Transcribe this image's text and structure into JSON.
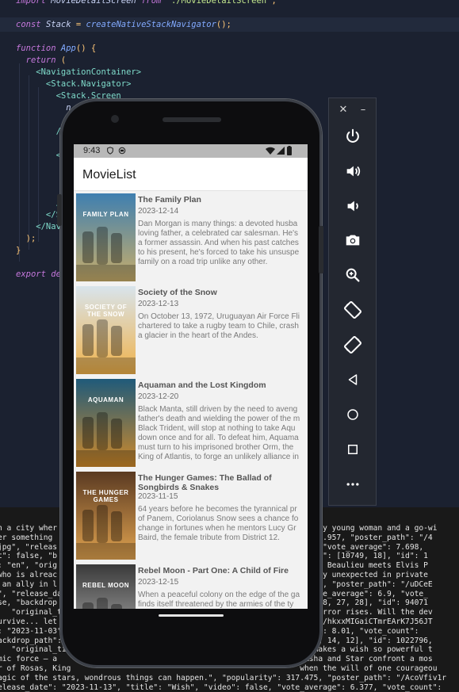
{
  "editor": {
    "lines": [
      {
        "parts": [
          [
            "kw",
            "import "
          ],
          [
            "id",
            "MovieDetailScreen "
          ],
          [
            "kw",
            "from "
          ],
          [
            "str",
            "'./MovieDetailScreen'"
          ],
          [
            "pun",
            ";"
          ]
        ]
      },
      {
        "parts": []
      },
      {
        "parts": [
          [
            "kw",
            "const "
          ],
          [
            "id",
            "Stack "
          ],
          [
            "pun",
            "= "
          ],
          [
            "fn",
            "createNativeStackNavigator"
          ],
          [
            "pun",
            "();"
          ]
        ]
      },
      {
        "parts": []
      },
      {
        "parts": [
          [
            "kw",
            "function "
          ],
          [
            "fn",
            "App"
          ],
          [
            "pun",
            "() {"
          ]
        ]
      },
      {
        "parts": [
          [
            "kw",
            "  return "
          ],
          [
            "pun",
            "("
          ]
        ]
      },
      {
        "parts": [
          [
            "tag",
            "    <NavigationContainer>"
          ]
        ]
      },
      {
        "parts": [
          [
            "tag",
            "      <Stack.Navigator>"
          ]
        ]
      },
      {
        "parts": [
          [
            "tag",
            "        <Stack.Screen"
          ]
        ]
      },
      {
        "parts": [
          [
            "id",
            "          n"
          ]
        ]
      },
      {
        "parts": []
      },
      {
        "parts": [
          [
            "tag",
            "        /"
          ]
        ]
      },
      {
        "parts": []
      },
      {
        "parts": [
          [
            "tag",
            "        <"
          ]
        ]
      },
      {
        "parts": []
      },
      {
        "parts": []
      },
      {
        "parts": []
      },
      {
        "parts": [
          [
            "tag",
            "        /"
          ]
        ]
      },
      {
        "parts": [
          [
            "tag",
            "      </S"
          ]
        ]
      },
      {
        "parts": [
          [
            "tag",
            "    </Nav"
          ]
        ]
      },
      {
        "parts": [
          [
            "pun",
            "  );"
          ]
        ]
      },
      {
        "parts": [
          [
            "pun",
            "}"
          ]
        ]
      },
      {
        "parts": []
      },
      {
        "parts": [
          [
            "kw",
            "export "
          ],
          [
            "kw",
            "de"
          ]
        ]
      }
    ]
  },
  "terminal": {
    "lines": [
      "n a city wher                                                      fiery young woman and a go-wi",
      "er something                                                      : 375.957, \"poster_path\": \"/4",
      "jpg\", \"releas                                                    alse, \"vote_average\": 7.698,",
      "t\": false, \"b                                                    re_ids\": [10749, 18], \"id\": 1",
      ": \"en\", \"orig                                                    scilla Beaulieu meets Elvis P",
      "who is alreac                                                     tirely unexpected in private",
      " an ally in l                                                     4.582, \"poster_path\": \"/uDCeE",
      "\", \"release_da                                                   , \"vote_average\": 6.9, \"vote_",
      "se, \"backdrop                                                     : [878, 27, 28], \"id\": 94071",
      "   \"original_t                                                    ew terror rises. Will the dev",
      "urvive... let                                                     h\": \"/hkxxMIGaiCTmrEArK7J56JT",
      ": \"2023-11-03\",                                                  erage\": 8.01, \"vote_count\":",
      "ackdrop_path\":                                                    0751, 14, 12], \"id\": 1022796,",
      "   \"original_ti                                                   t, makes a wish so powerful t",
      "mic force — a                                                    , Asha and Star confront a mos",
      "r of Rosas, King                                                  when the will of one courageou",
      "agic of the stars, wondrous things can happen.\", \"popularity\": 317.475, \"poster_path\": \"/AcoVfiv1r",
      "elease_date\": \"2023-11-13\", \"title\": \"Wish\", \"video\": false, \"vote_average\": 6.377, \"vote_count\":"
    ]
  },
  "toolbar": {
    "close_label": "✕",
    "minimize_label": "–",
    "buttons": [
      {
        "icon": "power-icon"
      },
      {
        "icon": "volume-up-icon"
      },
      {
        "icon": "volume-down-icon"
      },
      {
        "icon": "camera-icon"
      },
      {
        "icon": "zoom-in-icon"
      },
      {
        "icon": "rotate-left-icon"
      },
      {
        "icon": "rotate-right-icon"
      },
      {
        "icon": "back-icon"
      },
      {
        "icon": "home-icon"
      },
      {
        "icon": "overview-icon"
      },
      {
        "icon": "more-icon"
      }
    ]
  },
  "phone": {
    "status_time": "9:43",
    "app_title": "MovieList",
    "movies": [
      {
        "title": "The Family Plan",
        "date": "2023-12-14",
        "overview": [
          "Dan Morgan is many things: a devoted husba",
          "loving father, a celebrated car salesman. He's",
          "a former assassin. And when his past catches",
          "to his present, he's forced to take his unsuspe",
          "family on a road trip unlike any other."
        ],
        "poster_text": "FAMILY PLAN",
        "poster_colors": [
          "#3f7fb0",
          "#c9ae6a"
        ]
      },
      {
        "title": "Society of the Snow",
        "date": "2023-12-13",
        "overview": [
          "On October 13, 1972, Uruguayan Air Force Fli",
          "chartered to take a rugby team to Chile, crash",
          "a glacier in the heart of the Andes."
        ],
        "poster_text": "SOCIETY OF THE SNOW",
        "poster_colors": [
          "#d8e4ec",
          "#f0b24a"
        ]
      },
      {
        "title": "Aquaman and the Lost Kingdom",
        "date": "2023-12-20",
        "overview": [
          "Black Manta, still driven by the need to aveng",
          "father's death and wielding the power of the m",
          "Black Trident, will stop at nothing to take Aqu",
          "down once and for all. To defeat him, Aquama",
          "must turn to his imprisoned brother Orm, the",
          "King of Atlantis, to forge an unlikely alliance in"
        ],
        "poster_text": "AQUAMAN",
        "poster_colors": [
          "#1f5a7a",
          "#d08a2a"
        ]
      },
      {
        "title": "The Hunger Games: The Ballad of Songbirds & Snakes",
        "date": "2023-11-15",
        "overview": [
          "64 years before he becomes the tyrannical pr",
          "of Panem, Coriolanus Snow sees a chance fo",
          "change in fortunes when he mentors Lucy Gr",
          "Baird, the female tribute from District 12."
        ],
        "poster_text": "THE HUNGER GAMES",
        "poster_colors": [
          "#5a3a22",
          "#e2a450"
        ]
      },
      {
        "title": "Rebel Moon - Part One: A Child of Fire",
        "date": "2023-12-15",
        "overview": [
          "When a peaceful colony on the edge of the ga",
          "finds itself threatened by the armies of the ty"
        ],
        "poster_text": "REBEL MOON",
        "poster_colors": [
          "#3a3a3a",
          "#b9b9b9"
        ]
      }
    ]
  }
}
